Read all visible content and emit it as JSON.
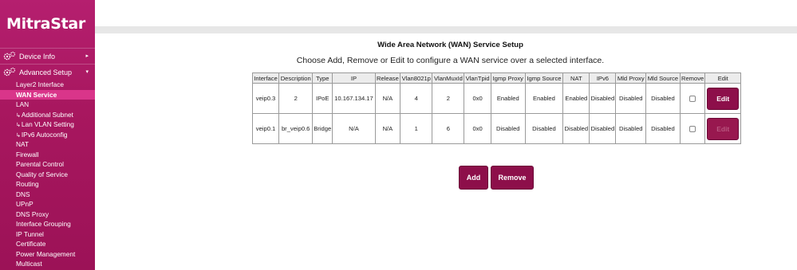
{
  "brand": {
    "logo_text": "MitraStar"
  },
  "colors": {
    "sidebar": "#a8175f",
    "active_item": "#d9358a",
    "button": "#8d0f4a"
  },
  "sidebar": {
    "device_info": {
      "label": "Device Info",
      "icon": "gear-icon"
    },
    "advanced_setup": {
      "label": "Advanced Setup",
      "icon": "gear-icon"
    },
    "items": [
      {
        "label": "Layer2 Interface",
        "hook": ""
      },
      {
        "label": "WAN Service",
        "hook": ""
      },
      {
        "label": "LAN",
        "hook": ""
      },
      {
        "label": "Additional Subnet",
        "hook": "↳"
      },
      {
        "label": "Lan VLAN Setting",
        "hook": "↳"
      },
      {
        "label": "IPv6 Autoconfig",
        "hook": "↳"
      },
      {
        "label": "NAT",
        "hook": ""
      },
      {
        "label": "Firewall",
        "hook": ""
      },
      {
        "label": "Parental Control",
        "hook": ""
      },
      {
        "label": "Quality of Service",
        "hook": ""
      },
      {
        "label": "Routing",
        "hook": ""
      },
      {
        "label": "DNS",
        "hook": ""
      },
      {
        "label": "UPnP",
        "hook": ""
      },
      {
        "label": "DNS Proxy",
        "hook": ""
      },
      {
        "label": "Interface Grouping",
        "hook": ""
      },
      {
        "label": "IP Tunnel",
        "hook": ""
      },
      {
        "label": "Certificate",
        "hook": ""
      },
      {
        "label": "Power Management",
        "hook": ""
      },
      {
        "label": "Multicast",
        "hook": ""
      }
    ]
  },
  "main": {
    "title": "Wide Area Network (WAN) Service Setup",
    "subtitle": "Choose Add, Remove or Edit to configure a WAN service over a selected interface.",
    "columns": [
      "Interface",
      "Description",
      "Type",
      "IP",
      "Release",
      "Vlan8021p",
      "VlanMuxId",
      "VlanTpid",
      "Igmp Proxy",
      "Igmp Source",
      "NAT",
      "IPv6",
      "Mld Proxy",
      "Mld Source",
      "Remove",
      "Edit"
    ],
    "rows": [
      {
        "cells": [
          "veip0.3",
          "2",
          "IPoE",
          "10.167.134.17",
          "N/A",
          "4",
          "2",
          "0x0",
          "Enabled",
          "Enabled",
          "Enabled",
          "Disabled",
          "Disabled",
          "Disabled"
        ],
        "remove_checked": false,
        "edit_label": "Edit",
        "edit_enabled": true
      },
      {
        "cells": [
          "veip0.1",
          "br_veip0.6",
          "Bridge",
          "N/A",
          "N/A",
          "1",
          "6",
          "0x0",
          "Disabled",
          "Disabled",
          "Disabled",
          "Disabled",
          "Disabled",
          "Disabled"
        ],
        "remove_checked": false,
        "edit_label": "Edit",
        "edit_enabled": false
      }
    ],
    "add_label": "Add",
    "remove_label": "Remove"
  }
}
